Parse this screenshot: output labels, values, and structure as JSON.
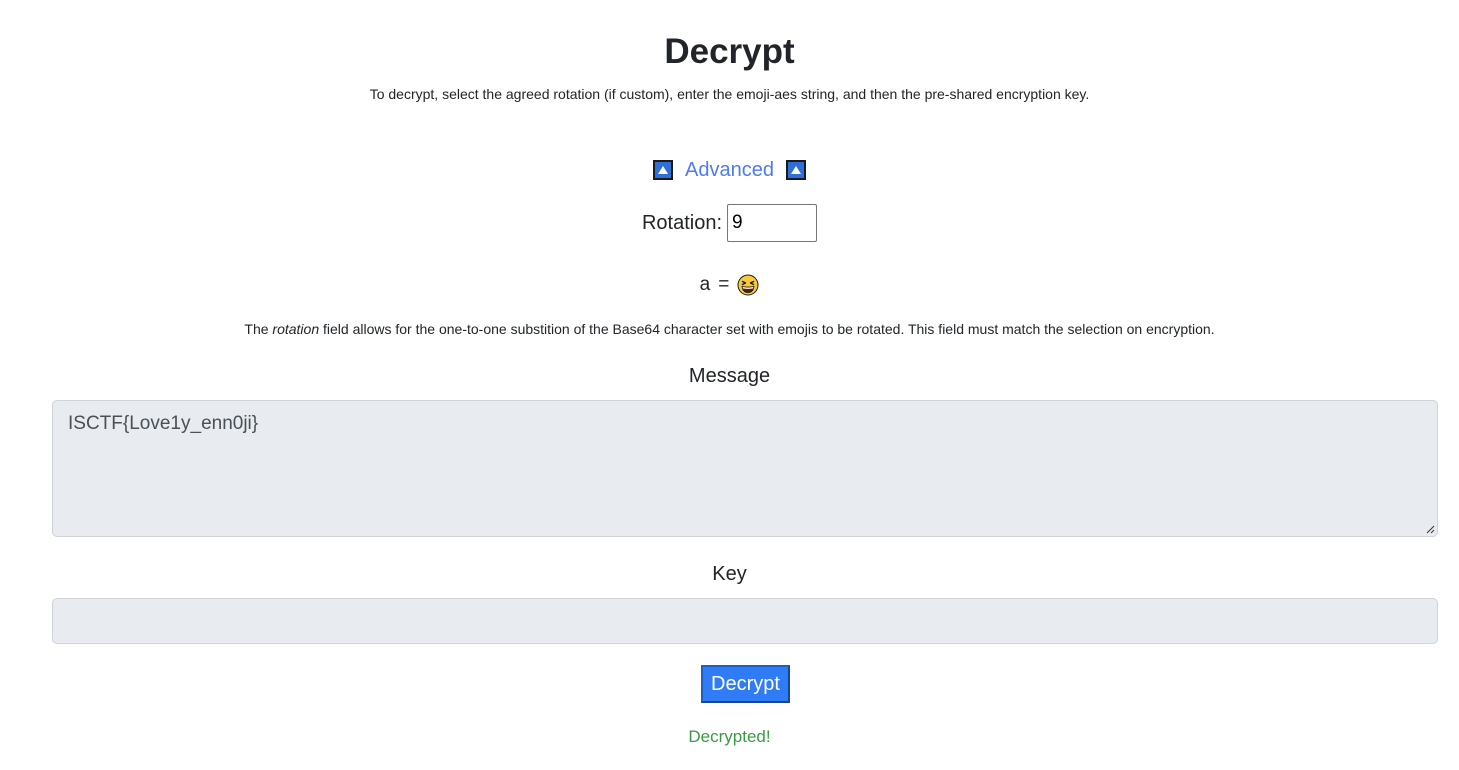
{
  "page": {
    "title": "Decrypt",
    "subtitle": "To decrypt, select the agreed rotation (if custom), enter the emoji-aes string, and then the pre-shared encryption key."
  },
  "advanced": {
    "label": "Advanced",
    "left_icon": "triangle-up-icon",
    "right_icon": "triangle-up-icon"
  },
  "rotation": {
    "label": "Rotation:",
    "value": "9"
  },
  "mapping": {
    "letter": "a",
    "equals": "=",
    "emoji_icon": "grinning-squinting-face-icon"
  },
  "explanation": {
    "prefix": "The ",
    "emphasis": "rotation",
    "suffix": " field allows for the one-to-one substition of the Base64 character set with emojis to be rotated. This field must match the selection on encryption."
  },
  "message": {
    "label": "Message",
    "value": "ISCTF{Love1y_enn0ji}"
  },
  "key": {
    "label": "Key",
    "value": ""
  },
  "actions": {
    "decrypt_label": "Decrypt"
  },
  "status": {
    "text": "Decrypted!",
    "color": "#3c9a45"
  },
  "colors": {
    "accent": "#2f7cf6",
    "link": "#4d7bf3",
    "field_bg": "#e8ebef"
  }
}
